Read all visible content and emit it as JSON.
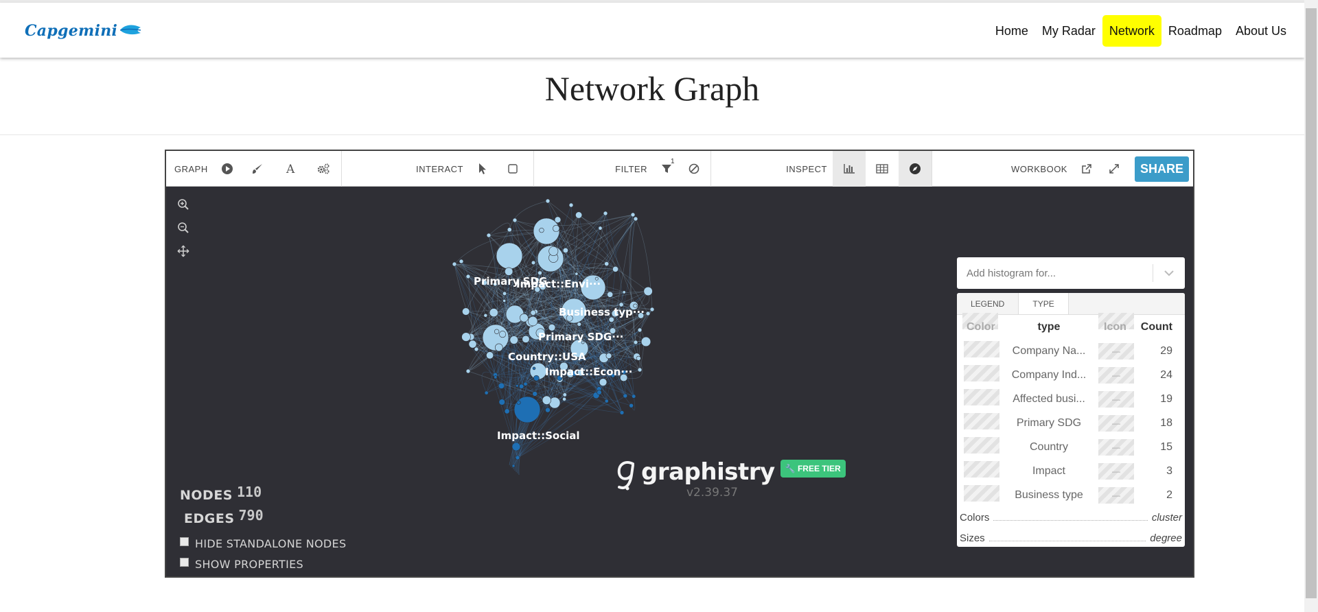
{
  "nav": {
    "logo_text": "Capgemini",
    "items": [
      {
        "label": "Home",
        "active": false
      },
      {
        "label": "My Radar",
        "active": false
      },
      {
        "label": "Network",
        "active": true
      },
      {
        "label": "Roadmap",
        "active": false
      },
      {
        "label": "About Us",
        "active": false
      }
    ],
    "active_color": "#ffff00"
  },
  "page": {
    "title": "Network Graph"
  },
  "toolbar": {
    "graph_label": "GRAPH",
    "interact_label": "INTERACT",
    "filter_label": "FILTER",
    "filter_count": "1",
    "inspect_label": "INSPECT",
    "workbook_label": "WORKBOOK",
    "share_label": "SHARE",
    "share_color": "#3b9cc9"
  },
  "stats": {
    "nodes_label": "NODES",
    "nodes_value": "110",
    "edges_label": "EDGES",
    "edges_value": "790",
    "hide_standalone_label": "HIDE STANDALONE NODES",
    "show_properties_label": "SHOW PROPERTIES"
  },
  "histogram": {
    "placeholder": "Add histogram for..."
  },
  "legend": {
    "tabs": [
      "LEGEND",
      "TYPE"
    ],
    "active_tab": "TYPE",
    "headers": {
      "color": "Color",
      "type": "type",
      "icon": "Icon",
      "count": "Count"
    },
    "rows": [
      {
        "type": "Company Na...",
        "icon": "—",
        "count": "29"
      },
      {
        "type": "Company Ind...",
        "icon": "—",
        "count": "24"
      },
      {
        "type": "Affected busi...",
        "icon": "—",
        "count": "19"
      },
      {
        "type": "Primary SDG",
        "icon": "—",
        "count": "18"
      },
      {
        "type": "Country",
        "icon": "—",
        "count": "15"
      },
      {
        "type": "Impact",
        "icon": "—",
        "count": "3"
      },
      {
        "type": "Business type",
        "icon": "—",
        "count": "2"
      }
    ],
    "colors_label": "Colors",
    "colors_value": "cluster",
    "sizes_label": "Sizes",
    "sizes_value": "degree"
  },
  "graph": {
    "background": "#2f2f35",
    "node_color": "#a8d2ec",
    "node_color_dark": "#1e6fb4",
    "labels": [
      "Primary SDG",
      "Impact::Envi···",
      "Business typ···",
      "Primary SDG···",
      "Country::USA",
      "Impact::Econ···",
      "Impact::Social"
    ]
  },
  "branding": {
    "name": "graphistry",
    "version": "v2.39.37",
    "badge": "FREE TIER",
    "badge_color": "#3cc47c"
  }
}
